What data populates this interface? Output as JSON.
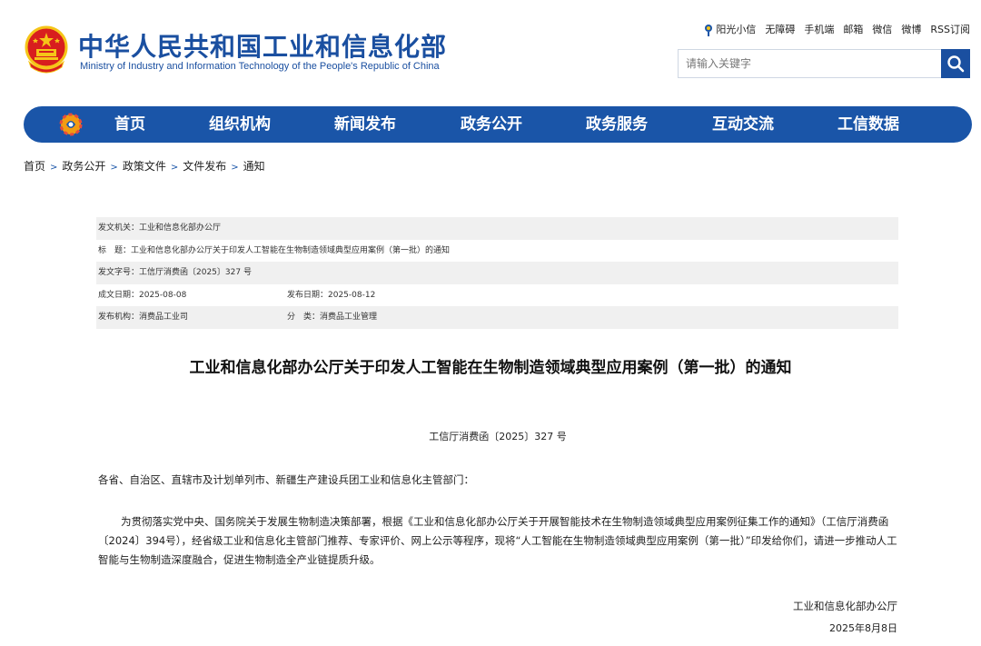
{
  "header": {
    "site_title": "中华人民共和国工业和信息化部",
    "site_subtitle": "Ministry of Industry and Information Technology of the People's Republic of China",
    "top_links": [
      "阳光小信",
      "无障碍",
      "手机端",
      "邮箱",
      "微信",
      "微博",
      "RSS订阅"
    ],
    "search_placeholder": "请输入关键字"
  },
  "nav": {
    "items": [
      "首页",
      "组织机构",
      "新闻发布",
      "政务公开",
      "政务服务",
      "互动交流",
      "工信数据"
    ]
  },
  "breadcrumb": [
    "首页",
    "政务公开",
    "政策文件",
    "文件发布",
    "通知"
  ],
  "meta": {
    "issuer": "发文机关：工业和信息化部办公厅",
    "title": "标　题：工业和信息化部办公厅关于印发人工智能在生物制造领域典型应用案例（第一批）的通知",
    "doc_number": "发文字号：工信厅消费函〔2025〕327 号",
    "created_date": "成文日期：2025-08-08",
    "published_date": "发布日期：2025-08-12",
    "publisher": "发布机构：消费品工业司",
    "category": "分　类：消费品工业管理"
  },
  "article": {
    "title": "工业和信息化部办公厅关于印发人工智能在生物制造领域典型应用案例（第一批）的通知",
    "doc_number": "工信厅消费函〔2025〕327 号",
    "salutation": "各省、自治区、直辖市及计划单列市、新疆生产建设兵团工业和信息化主管部门：",
    "body": "为贯彻落实党中央、国务院关于发展生物制造决策部署，根据《工业和信息化部办公厅关于开展智能技术在生物制造领域典型应用案例征集工作的通知》（工信厅消费函〔2024〕394号），经省级工业和信息化主管部门推荐、专家评价、网上公示等程序，现将“人工智能在生物制造领域典型应用案例（第一批）”印发给你们，请进一步推动人工智能与生物制造深度融合，促进生物制造全产业链提质升级。",
    "signature": "工业和信息化部办公厅",
    "date": "2025年8月8日"
  },
  "colors": {
    "brand_blue": "#1a55a8",
    "title_blue": "#1a4fa0",
    "emblem_red": "#d81e1e",
    "emblem_gold": "#f5c518"
  },
  "icons": {
    "emblem": "national-emblem-icon",
    "search": "search-icon",
    "sun": "sunshine-icon",
    "nav_logo": "miit-logo-icon"
  }
}
